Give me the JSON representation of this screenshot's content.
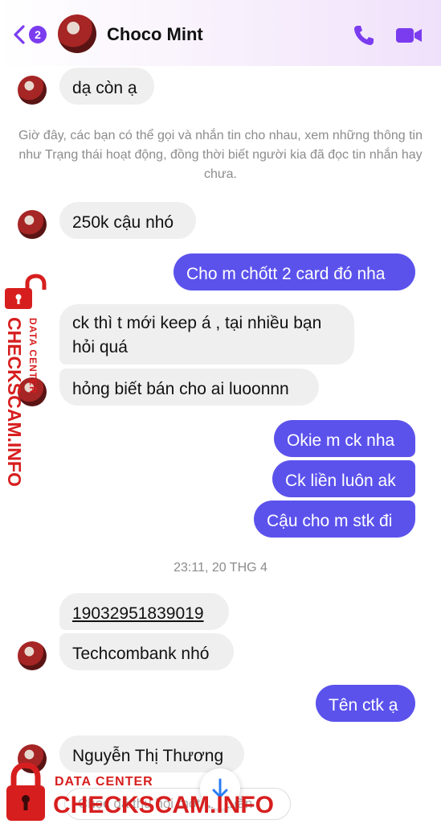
{
  "header": {
    "back_badge": "2",
    "contact_name": "Choco Mint",
    "accent": "#7b3cf0"
  },
  "messages": [
    {
      "from": "them",
      "text": "dạ còn ạ"
    },
    {
      "system": "Giờ đây, các bạn có thể gọi và nhắn tin cho nhau, xem những thông tin như Trạng thái hoạt động, đồng thời biết người kia đã đọc tin nhắn hay chưa."
    },
    {
      "from": "them",
      "text": "250k cậu nhó"
    },
    {
      "from": "me",
      "text": "Cho m chốtt 2 card đó nha"
    },
    {
      "from": "them",
      "text": "ck thì t mới keep á , tại nhiều bạn hỏi quá"
    },
    {
      "from": "them",
      "text": "hỏng biết bán cho ai luoonnn"
    },
    {
      "from": "me",
      "text": "Okie m ck nha"
    },
    {
      "from": "me",
      "text": "Ck liền luôn ak"
    },
    {
      "from": "me",
      "text": "Cậu cho m stk đi"
    },
    {
      "timestamp": "23:11, 20 THG 4"
    },
    {
      "from": "them",
      "text": "19032951839019"
    },
    {
      "from": "them",
      "text": "Techcombank nhó"
    },
    {
      "from": "me",
      "text": "Tên ctk ạ"
    },
    {
      "from": "them",
      "text": "Nguyễn Thị Thương"
    }
  ],
  "composer": {
    "placeholder": "Chọc đã thu hồi một tin nhắn"
  },
  "watermark": {
    "top": "DATA CENTER",
    "main": "CHECKSCAM.INFO"
  },
  "colors": {
    "incoming": "#efefef",
    "outgoing": "#5b52ec",
    "brand_red": "#d71e1e"
  }
}
